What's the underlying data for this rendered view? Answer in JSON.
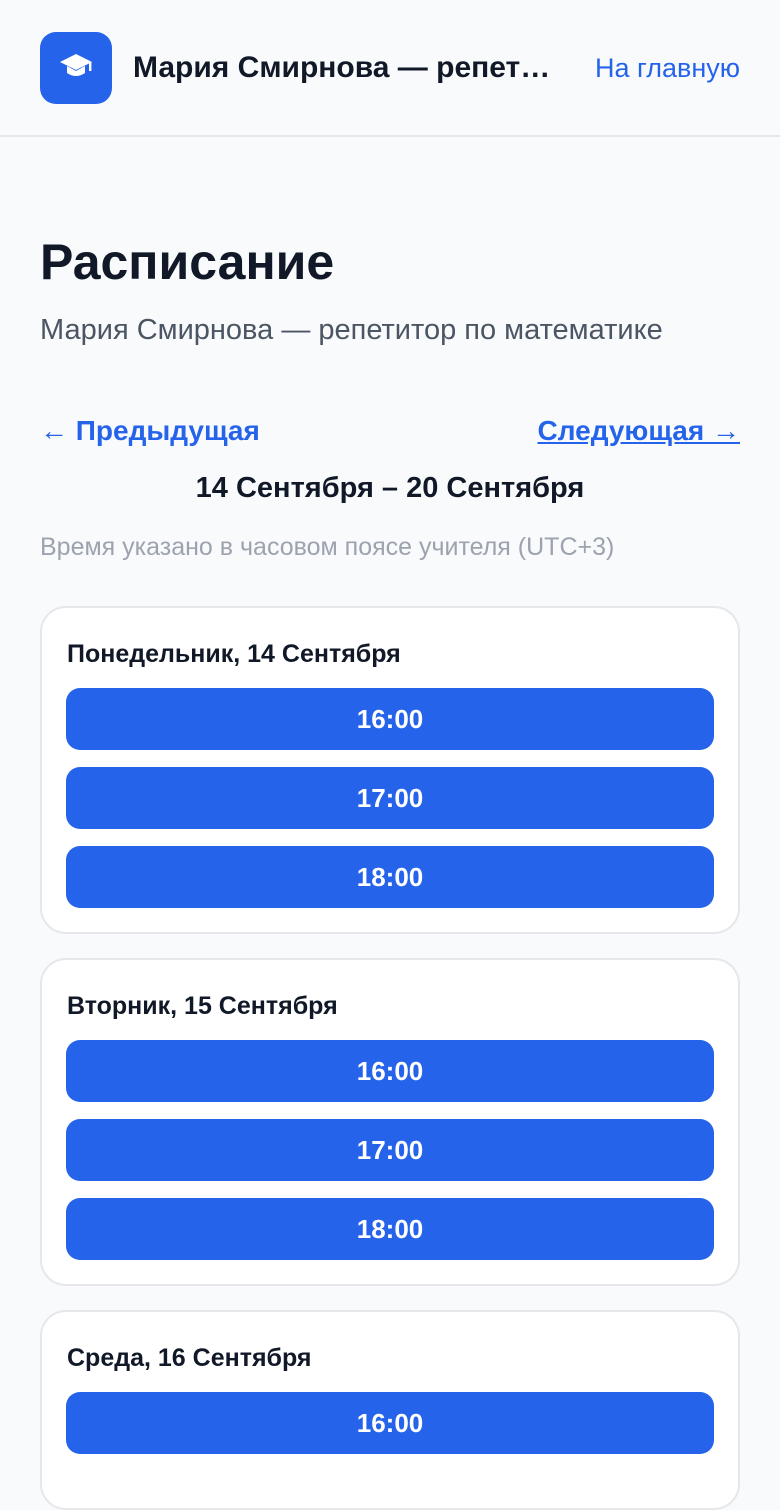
{
  "header": {
    "logo_icon": "graduation-cap-icon",
    "site_title": "Мария Смирнова — репетитор по математике",
    "home_link": "На главную"
  },
  "page": {
    "title": "Расписание",
    "subtitle": "Мария Смирнова — репетитор по математике"
  },
  "week_nav": {
    "prev": "← Предыдущая",
    "next": "Следующая →",
    "range": "14 Сентября – 20 Сентября"
  },
  "timezone_note": "Время указано в часовом поясе учителя (UTC+3)",
  "days": [
    {
      "label": "Понедельник, 14 Сентября",
      "slots": [
        "16:00",
        "17:00",
        "18:00"
      ]
    },
    {
      "label": "Вторник, 15 Сентября",
      "slots": [
        "16:00",
        "17:00",
        "18:00"
      ]
    },
    {
      "label": "Среда, 16 Сентября",
      "slots": [
        "16:00"
      ]
    }
  ],
  "colors": {
    "accent": "#2563eb",
    "background": "#f9fafb",
    "card": "#ffffff",
    "muted": "#9ca3af"
  }
}
